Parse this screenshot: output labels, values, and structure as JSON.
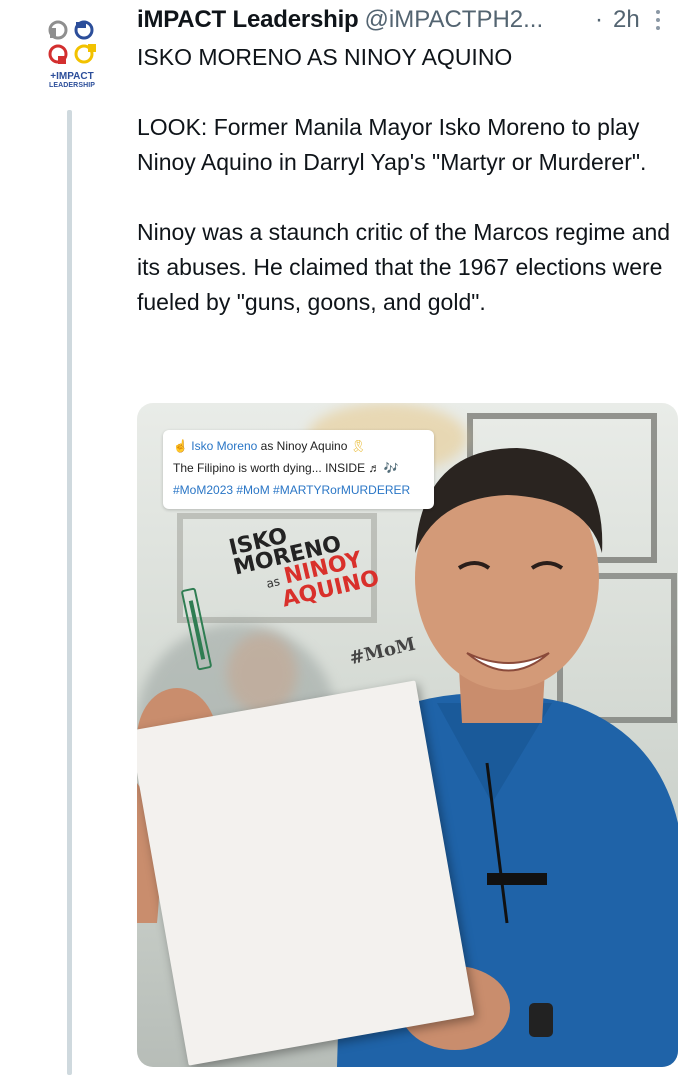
{
  "author": {
    "display_name": "iMPACT Leadership",
    "handle": "@iMPACTPH2...",
    "separator": "·",
    "time": "2h",
    "avatar_label_line1": "+IMPACT",
    "avatar_label_line2": "LEADERSHIP"
  },
  "tweet": {
    "title": "ISKO MORENO AS NINOY AQUINO",
    "paragraph1": "LOOK: Former Manila Mayor Isko Moreno to play Ninoy Aquino in Darryl Yap's \"Martyr or Murderer\".",
    "paragraph2": "Ninoy was a staunch critic of the Marcos regime and its abuses. He claimed that the 1967 elections were fueled by \"guns, goons, and gold\"."
  },
  "media": {
    "caption_name": "Isko Moreno",
    "caption_rest": " as Ninoy Aquino",
    "caption_line2": "The Filipino is worth dying... INSIDE ♬ 🎶",
    "caption_line3": "#MoM2023 #MoM #MARTYRorMURDERER",
    "paper_line1": "ISKO",
    "paper_line2": "MORENO",
    "paper_as": "as",
    "paper_line3": "NINOY",
    "paper_line4": "AQUINO",
    "paper_tag": "#MoM"
  },
  "icons": [
    "avatar-logo-icon",
    "more-options-icon"
  ],
  "colors": {
    "text": "#0f1419",
    "secondary": "#536471",
    "thread_line": "#cfd9de",
    "hashtag_blue": "#2a76c6",
    "paper_red": "#d9302b"
  }
}
